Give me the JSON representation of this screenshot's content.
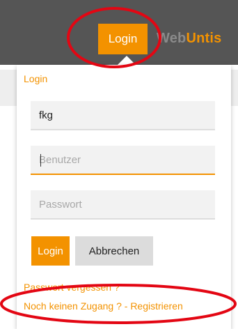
{
  "header": {
    "login_button": "Login",
    "brand_web": "Web",
    "brand_untis": "Untis"
  },
  "panel": {
    "title": "Login",
    "school_value": "fkg",
    "user_placeholder": "Benutzer",
    "password_placeholder": "Passwort",
    "login_button": "Login",
    "cancel_button": "Abbrechen",
    "forgot_link": "Passwort vergessen ?",
    "register_link": "Noch keinen Zugang ? - Registrieren"
  },
  "colors": {
    "accent": "#f39200",
    "topbar": "#555555",
    "annotation": "#e30613"
  }
}
